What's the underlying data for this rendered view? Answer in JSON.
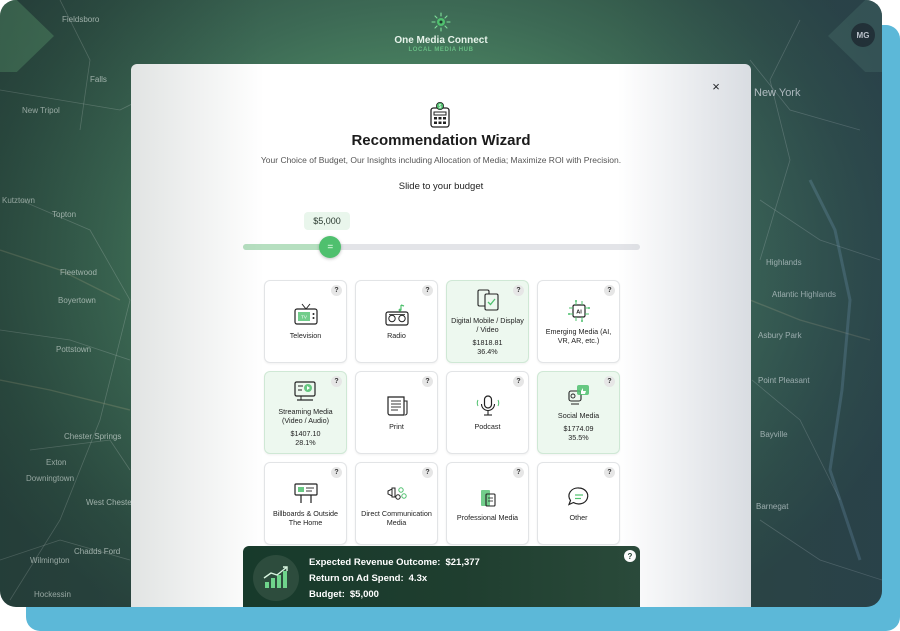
{
  "brand": {
    "name": "One Media Connect",
    "subtitle": "LOCAL MEDIA HUB"
  },
  "user": {
    "initials": "MG"
  },
  "map": {
    "labels": [
      "Fieldsboro",
      "Falls",
      "New Tripol",
      "Kutztown",
      "Topton",
      "Fleetwood",
      "Boyertown",
      "Pottstown",
      "Chester Springs",
      "Exton",
      "Downingtown",
      "West Chester",
      "Chadds Ford",
      "Wilmington",
      "Hockessin",
      "New York",
      "Highlands",
      "Asbury Park",
      "Point Pleasant",
      "Atlantic Highlands",
      "Bayville",
      "Barnegat"
    ]
  },
  "wizard": {
    "title": "Recommendation Wizard",
    "subtitle": "Your Choice of Budget, Our Insights including Allocation of Media; Maximize ROI with Precision.",
    "slider_title": "Slide to your budget",
    "budget_label": "$5,000",
    "budget_fraction": 0.22,
    "thumb_symbol": "=",
    "close_symbol": "×",
    "help_symbol": "?"
  },
  "media_cards": [
    {
      "label": "Television",
      "icon": "television-icon",
      "active": false,
      "amount": "",
      "percent": ""
    },
    {
      "label": "Radio",
      "icon": "radio-icon",
      "active": false,
      "amount": "",
      "percent": ""
    },
    {
      "label": "Digital Mobile / Display / Video",
      "icon": "mobile-display-icon",
      "active": true,
      "amount": "$1818.81",
      "percent": "36.4%"
    },
    {
      "label": "Emerging Media (AI, VR, AR, etc.)",
      "icon": "ai-chip-icon",
      "active": false,
      "amount": "",
      "percent": ""
    },
    {
      "label": "Streaming Media (Video / Audio)",
      "icon": "streaming-icon",
      "active": true,
      "amount": "$1407.10",
      "percent": "28.1%"
    },
    {
      "label": "Print",
      "icon": "newspaper-icon",
      "active": false,
      "amount": "",
      "percent": ""
    },
    {
      "label": "Podcast",
      "icon": "microphone-icon",
      "active": false,
      "amount": "",
      "percent": ""
    },
    {
      "label": "Social Media",
      "icon": "social-media-icon",
      "active": true,
      "amount": "$1774.09",
      "percent": "35.5%"
    },
    {
      "label": "Billboards & Outside The Home",
      "icon": "billboard-icon",
      "active": false,
      "amount": "",
      "percent": ""
    },
    {
      "label": "Direct Communication Media",
      "icon": "direct-mail-icon",
      "active": false,
      "amount": "",
      "percent": ""
    },
    {
      "label": "Professional Media",
      "icon": "professional-media-icon",
      "active": false,
      "amount": "",
      "percent": ""
    },
    {
      "label": "Other",
      "icon": "chat-bubble-icon",
      "active": false,
      "amount": "",
      "percent": ""
    }
  ],
  "outcome": {
    "revenue_label": "Expected Revenue Outcome:",
    "revenue_value": "$21,377",
    "roas_label": "Return on Ad Spend:",
    "roas_value": "4.3x",
    "budget_label": "Budget:",
    "budget_value": "$5,000",
    "icon": "growth-chart-icon"
  },
  "colors": {
    "accent": "#4fc06e",
    "card_active_bg": "#edf8ef",
    "outcome_bg": "#1f3e2f",
    "frame_shadow": "#5cb8d8"
  }
}
